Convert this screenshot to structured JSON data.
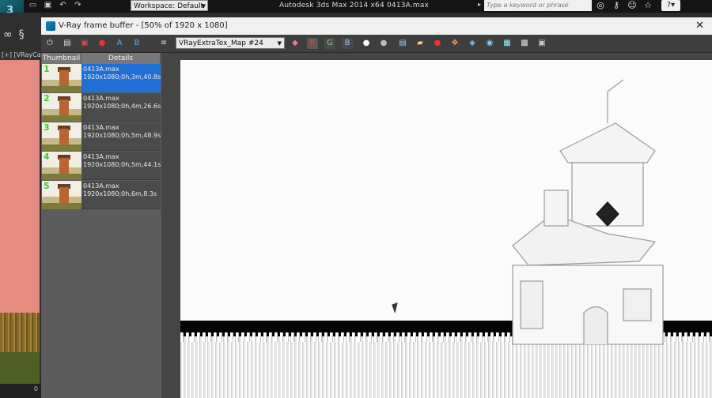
{
  "max": {
    "title": "Autodesk 3ds Max  2014 x64      0413A.max",
    "workspace": "Workspace: Default",
    "search_placeholder": "Type a keyword or phrase",
    "viewport_label": "[+] [VRayCa",
    "frame_value": "0",
    "qa_icons": [
      "folder-open-icon",
      "save-icon",
      "undo-icon",
      "redo-icon"
    ],
    "right_icons": [
      "binoculars-icon",
      "key-icon",
      "user-icon",
      "star-icon"
    ]
  },
  "vfb": {
    "title": "V-Ray frame buffer - [50% of 1920 x 1080]",
    "channel": "VRayExtraTex_Map #24",
    "history_columns": [
      "Thumbnail",
      "Details"
    ],
    "history": [
      {
        "num": "1",
        "file": "0413A.max",
        "info": "1920x1080;0h,3m,40.8s",
        "selected": true
      },
      {
        "num": "2",
        "file": "0413A.max",
        "info": "1920x1080;0h,4m,26.6s",
        "selected": false
      },
      {
        "num": "3",
        "file": "0413A.max",
        "info": "1920x1080;0h,5m,48.9s",
        "selected": false
      },
      {
        "num": "4",
        "file": "0413A.max",
        "info": "1920x1080;0h,5m,44.1s",
        "selected": false
      },
      {
        "num": "5",
        "file": "0413A.max",
        "info": "1920x1080;0h,6m,8.3s",
        "selected": false
      }
    ],
    "toolbar": {
      "red_channel": "R",
      "green_channel": "G",
      "blue_channel": "B"
    }
  }
}
